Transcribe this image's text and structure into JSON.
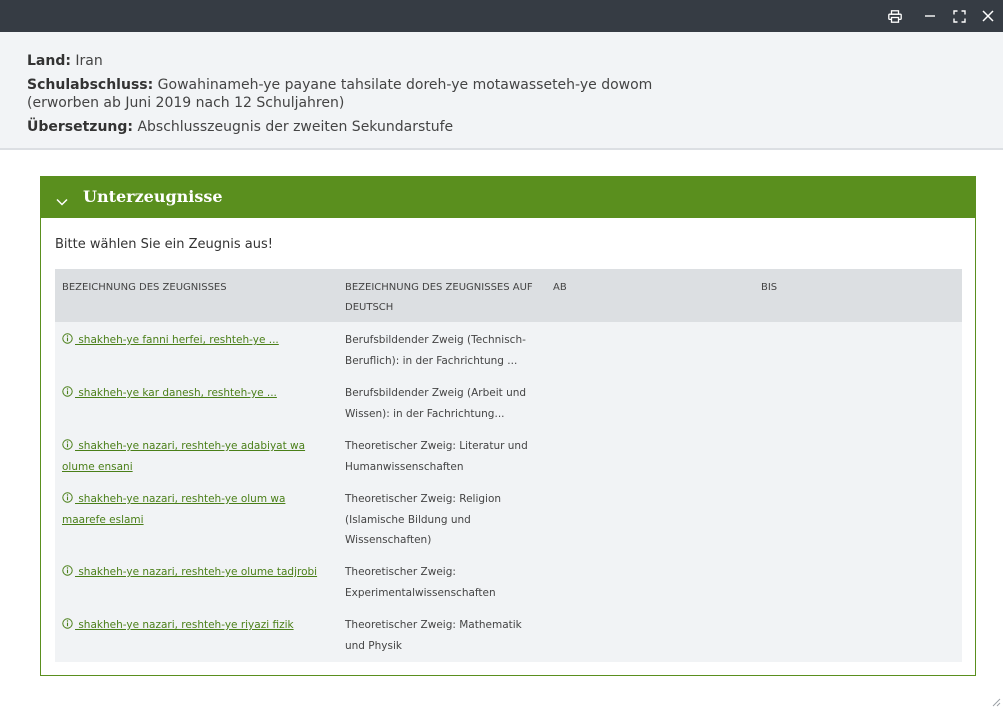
{
  "window": {
    "controls": [
      "printer-icon",
      "minimize-icon",
      "maximize-icon",
      "close-icon"
    ]
  },
  "info": {
    "country_label": "Land:",
    "country_value": "Iran",
    "degree_label": "Schulabschluss:",
    "degree_value": "Gowahinameh-ye payane tahsilate doreh-ye motawasseteh-ye dowom (erworben ab Juni 2019 nach 12 Schuljahren)",
    "translation_label": "Übersetzung:",
    "translation_value": "Abschlusszeugnis der zweiten Sekundarstufe"
  },
  "section": {
    "title": "Unterzeugnisse",
    "prompt": "Bitte wählen Sie ein Zeugnis aus!",
    "columns": {
      "name": "BEZEICHNUNG DES ZEUGNISSES",
      "name_de": "BEZEICHNUNG DES ZEUGNISSES AUF DEUTSCH",
      "from": "AB",
      "to": "BIS"
    },
    "rows": [
      {
        "name": " shakheh-ye fanni herfei, reshteh-ye ...",
        "name_de": "Berufsbildender Zweig (Technisch-Beruflich): in der Fachrichtung ..."
      },
      {
        "name": " shakheh-ye kar danesh, reshteh-ye ...",
        "name_de": "Berufsbildender Zweig (Arbeit und Wissen): in der Fachrichtung..."
      },
      {
        "name": " shakheh-ye nazari, reshteh-ye adabiyat wa olume ensani",
        "name_de": "Theoretischer Zweig: Literatur und Humanwissenschaften"
      },
      {
        "name": " shakheh-ye nazari, reshteh-ye olum wa maarefe eslami",
        "name_de": "Theoretischer Zweig: Religion (Islamische Bildung und Wissenschaften)"
      },
      {
        "name": " shakheh-ye nazari, reshteh-ye olume tadjrobi",
        "name_de": "Theoretischer Zweig: Experimentalwissenschaften"
      },
      {
        "name": " shakheh-ye nazari, reshteh-ye riyazi fizik",
        "name_de": "Theoretischer Zweig: Mathematik und Physik"
      }
    ]
  },
  "colors": {
    "titlebar": "#363c44",
    "accent_green": "#5a8f1e",
    "link_green": "#4a7f18",
    "table_header": "#dcdfe2",
    "table_body": "#f1f3f5"
  }
}
